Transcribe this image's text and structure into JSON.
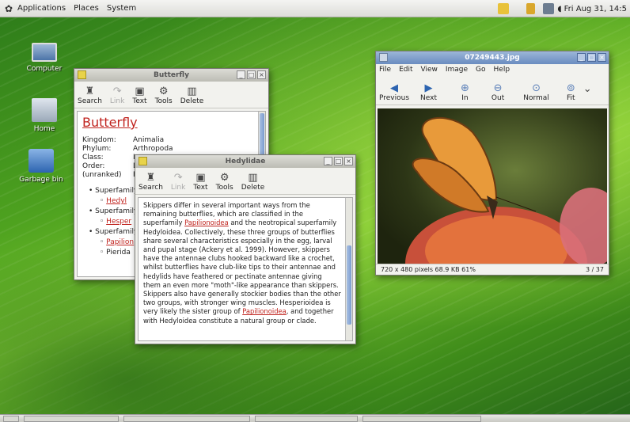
{
  "top_panel": {
    "menus": [
      "Applications",
      "Places",
      "System"
    ],
    "clock": "Fri Aug 31, 14:5"
  },
  "desktop_icons": [
    "Computer",
    "Home",
    "Garbage bin"
  ],
  "taskbar": [
    "",
    "",
    "",
    "",
    ""
  ],
  "butterfly_window": {
    "title": "Butterfly",
    "toolbar": [
      "Search",
      "Link",
      "Text",
      "Tools",
      "Delete"
    ],
    "heading": "Butterfly",
    "taxonomy": [
      {
        "k": "Kingdom:",
        "v": "Animalia"
      },
      {
        "k": "Phylum:",
        "v": "Arthropoda"
      },
      {
        "k": "Class:",
        "v": "In"
      },
      {
        "k": "Order:",
        "v": "L"
      },
      {
        "k": "(unranked)",
        "v": "R"
      }
    ],
    "bullets": [
      {
        "text": "Superfamily",
        "sub": "Hedyl"
      },
      {
        "text": "Superfamily",
        "sub": "Hesper"
      },
      {
        "text": "Superfamily",
        "sub": "Papilion"
      },
      {
        "text": "",
        "sub": "Pierida"
      }
    ]
  },
  "hedylidae_window": {
    "title": "Hedylidae",
    "toolbar": [
      "Search",
      "Link",
      "Text",
      "Tools",
      "Delete"
    ],
    "text_1": "Skippers differ in several important ways from the remaining butterflies, which are classified in the superfamily ",
    "link_1": "Papilionoidea",
    "text_2": " and the neotropical superfamily Hedyloidea. Collectively, these three groups of butterflies share several characteristics especially in the egg, larval and pupal stage (Ackery et al. 1999). However, skippers have the antennae clubs hooked backward like a crochet, whilst butterflies have club-like tips to their antennae and hedylids have feathered or pectinate antennae giving them an even more \"moth\"-like appearance than skippers. Skippers also have generally stockier bodies than the other two groups, with stronger wing muscles. Hesperioidea is very likely the sister group of ",
    "link_2": "Papilionoidea",
    "text_3": ", and together with Hedyloidea constitute a natural group or clade."
  },
  "image_viewer": {
    "title": "07249443.jpg",
    "menus": [
      "File",
      "Edit",
      "View",
      "Image",
      "Go",
      "Help"
    ],
    "toolbar": [
      "Previous",
      "Next",
      "In",
      "Out",
      "Normal",
      "Fit"
    ],
    "status_left": "720 x 480 pixels  68.9 KB  61%",
    "status_right": "3 / 37"
  }
}
